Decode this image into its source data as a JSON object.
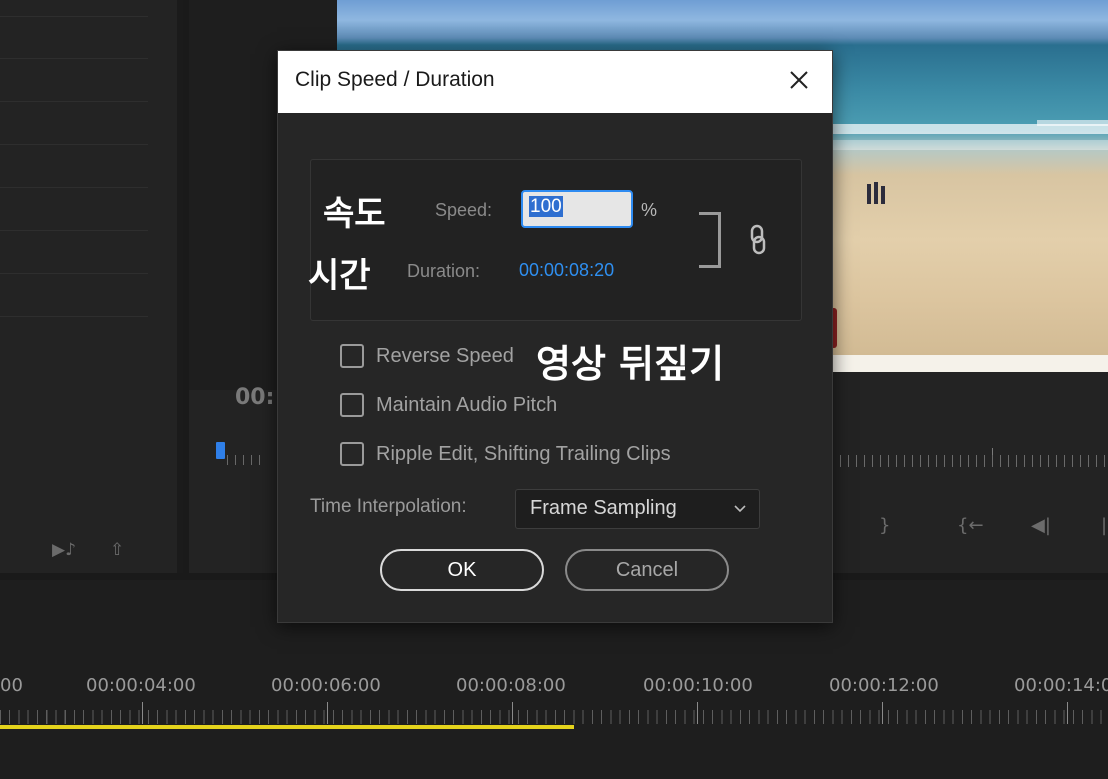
{
  "left_panel": {
    "controls": [
      "▶♪",
      "⇧"
    ]
  },
  "monitor": {
    "timecode": "00:",
    "transport_icons": [
      "}",
      "{←",
      "◀|",
      "|"
    ]
  },
  "timeline": {
    "time_labels": [
      "00",
      "00:00:04:00",
      "00:00:06:00",
      "00:00:08:00",
      "00:00:10:00",
      "00:00:12:00",
      "00:00:14:0"
    ]
  },
  "dialog": {
    "title": "Clip Speed / Duration",
    "annotations": {
      "speed_ko": "속도",
      "duration_ko": "시간",
      "reverse_ko": "영상 뒤짚기"
    },
    "speed_label": "Speed:",
    "speed_value": "100",
    "speed_unit": "%",
    "duration_label": "Duration:",
    "duration_value": "00:00:08:20",
    "checkboxes": [
      {
        "label": "Reverse Speed",
        "checked": false
      },
      {
        "label": "Maintain Audio Pitch",
        "checked": false
      },
      {
        "label": "Ripple Edit, Shifting Trailing Clips",
        "checked": false
      }
    ],
    "interpolation_label": "Time Interpolation:",
    "interpolation_value": "Frame Sampling",
    "ok_label": "OK",
    "cancel_label": "Cancel"
  },
  "colors": {
    "accent": "#2f8ff0",
    "work_area": "#e4d31c"
  }
}
